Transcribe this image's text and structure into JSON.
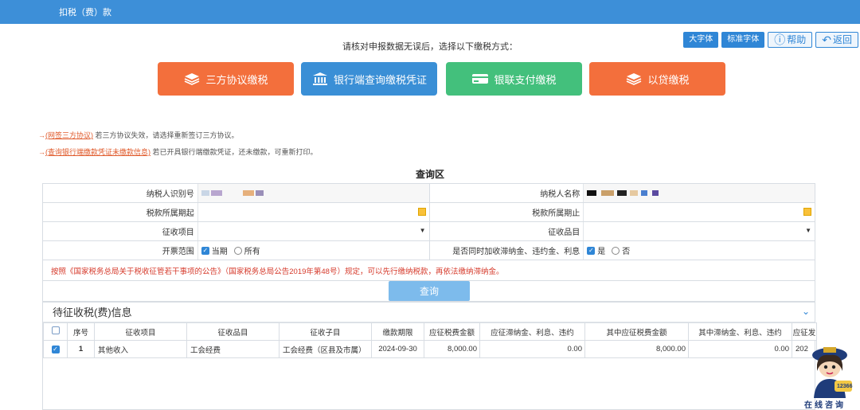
{
  "header": {
    "title": "扣税（费）款"
  },
  "toolbar": {
    "large_font": "大字体",
    "std_font": "标准字体",
    "help": "帮助",
    "back": "返回"
  },
  "instruction": "请核对申报数据无误后，选择以下缴税方式：",
  "payment_methods": [
    {
      "label": "三方协议缴税",
      "color": "#f36f3c"
    },
    {
      "label": "银行端查询缴税凭证",
      "color": "#3a8fd6"
    },
    {
      "label": "银联支付缴税",
      "color": "#43c07c"
    },
    {
      "label": "以贷缴税",
      "color": "#f36f3c"
    }
  ],
  "notices": [
    {
      "arrow": "→",
      "link": "(网签三方协议)",
      "text": "若三方协议失效，请选择重新签订三方协议。"
    },
    {
      "arrow": "→",
      "link": "(查询银行端缴款凭证未缴款信息)",
      "text": "若已开具银行端缴款凭证，还未缴款，可重新打印。"
    }
  ],
  "query": {
    "title": "查询区",
    "taxpayer_id_label": "纳税人识别号",
    "taxpayer_name_label": "纳税人名称",
    "period_start_label": "税款所属期起",
    "period_end_label": "税款所属期止",
    "item_label": "征收项目",
    "sub_item_label": "征收品目",
    "invoice_scope_label": "开票范围",
    "opt_current": "当期",
    "opt_all": "所有",
    "late_fee_label": "是否同时加收滞纳金、违约金、利息",
    "opt_yes": "是",
    "opt_no": "否",
    "law_notice": "按照《国家税务总局关于税收征管若干事项的公告》（国家税务总局公告2019年第48号）规定，可以先行缴纳税款，再依法缴纳滞纳金。",
    "query_button": "查询"
  },
  "pending": {
    "title": "待征收税(费)信息",
    "columns": [
      "序号",
      "征收项目",
      "征收品目",
      "征收子目",
      "缴款期限",
      "应征税费金额",
      "应征滞纳金、利息、违约",
      "其中应征税费金额",
      "其中滞纳金、利息、违约",
      "应征发"
    ],
    "rows": [
      {
        "index": "1",
        "item": "其他收入",
        "sub_item": "工会经费",
        "child_item": "工会经费（区县及市属）",
        "deadline": "2024-09-30",
        "amount": "8,000.00",
        "late_fee": "0.00",
        "amount_inner": "8,000.00",
        "late_fee_inner": "0.00",
        "extra": "202"
      }
    ]
  },
  "mascot": {
    "caption": "在线咨询",
    "badge": "12366"
  }
}
